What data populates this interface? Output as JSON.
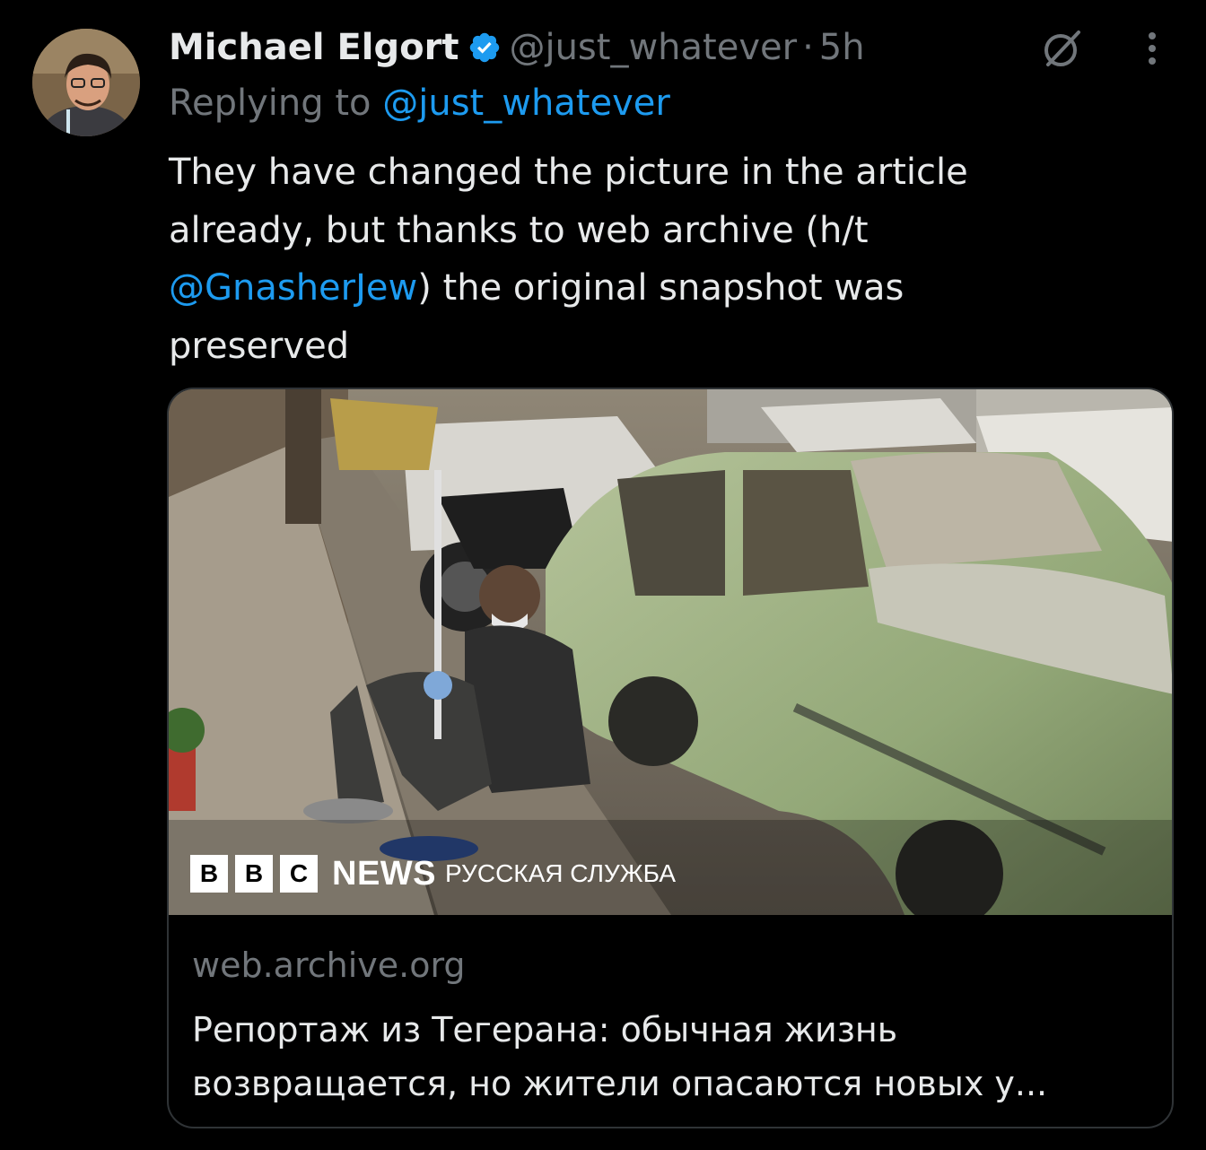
{
  "tweet": {
    "author_name": "Michael Elgort",
    "author_handle": "@just_whatever",
    "separator": "·",
    "time": "5h",
    "reply_prefix": "Replying to",
    "reply_to": "@just_whatever",
    "text_part1": "They have changed the picture in the article already, but thanks to web archive (h/t ",
    "text_mention": "@GnasherJew",
    "text_part2": ") the original snapshot was preserved"
  },
  "card": {
    "logo_letters": [
      "B",
      "B",
      "C"
    ],
    "logo_news": "NEWS",
    "logo_service": "РУССКАЯ СЛУЖБА",
    "domain": "web.archive.org",
    "title": "Репортаж из Тегерана: обычная жизнь возвращается, но жители опасаются новых у..."
  },
  "icons": {
    "verified": "verified-badge-icon",
    "grok": "grok-icon",
    "more": "more-options-icon"
  },
  "colors": {
    "background": "#000000",
    "text": "#e7e9ea",
    "muted": "#71767b",
    "link": "#1d9bf0",
    "border": "#2f3336"
  }
}
